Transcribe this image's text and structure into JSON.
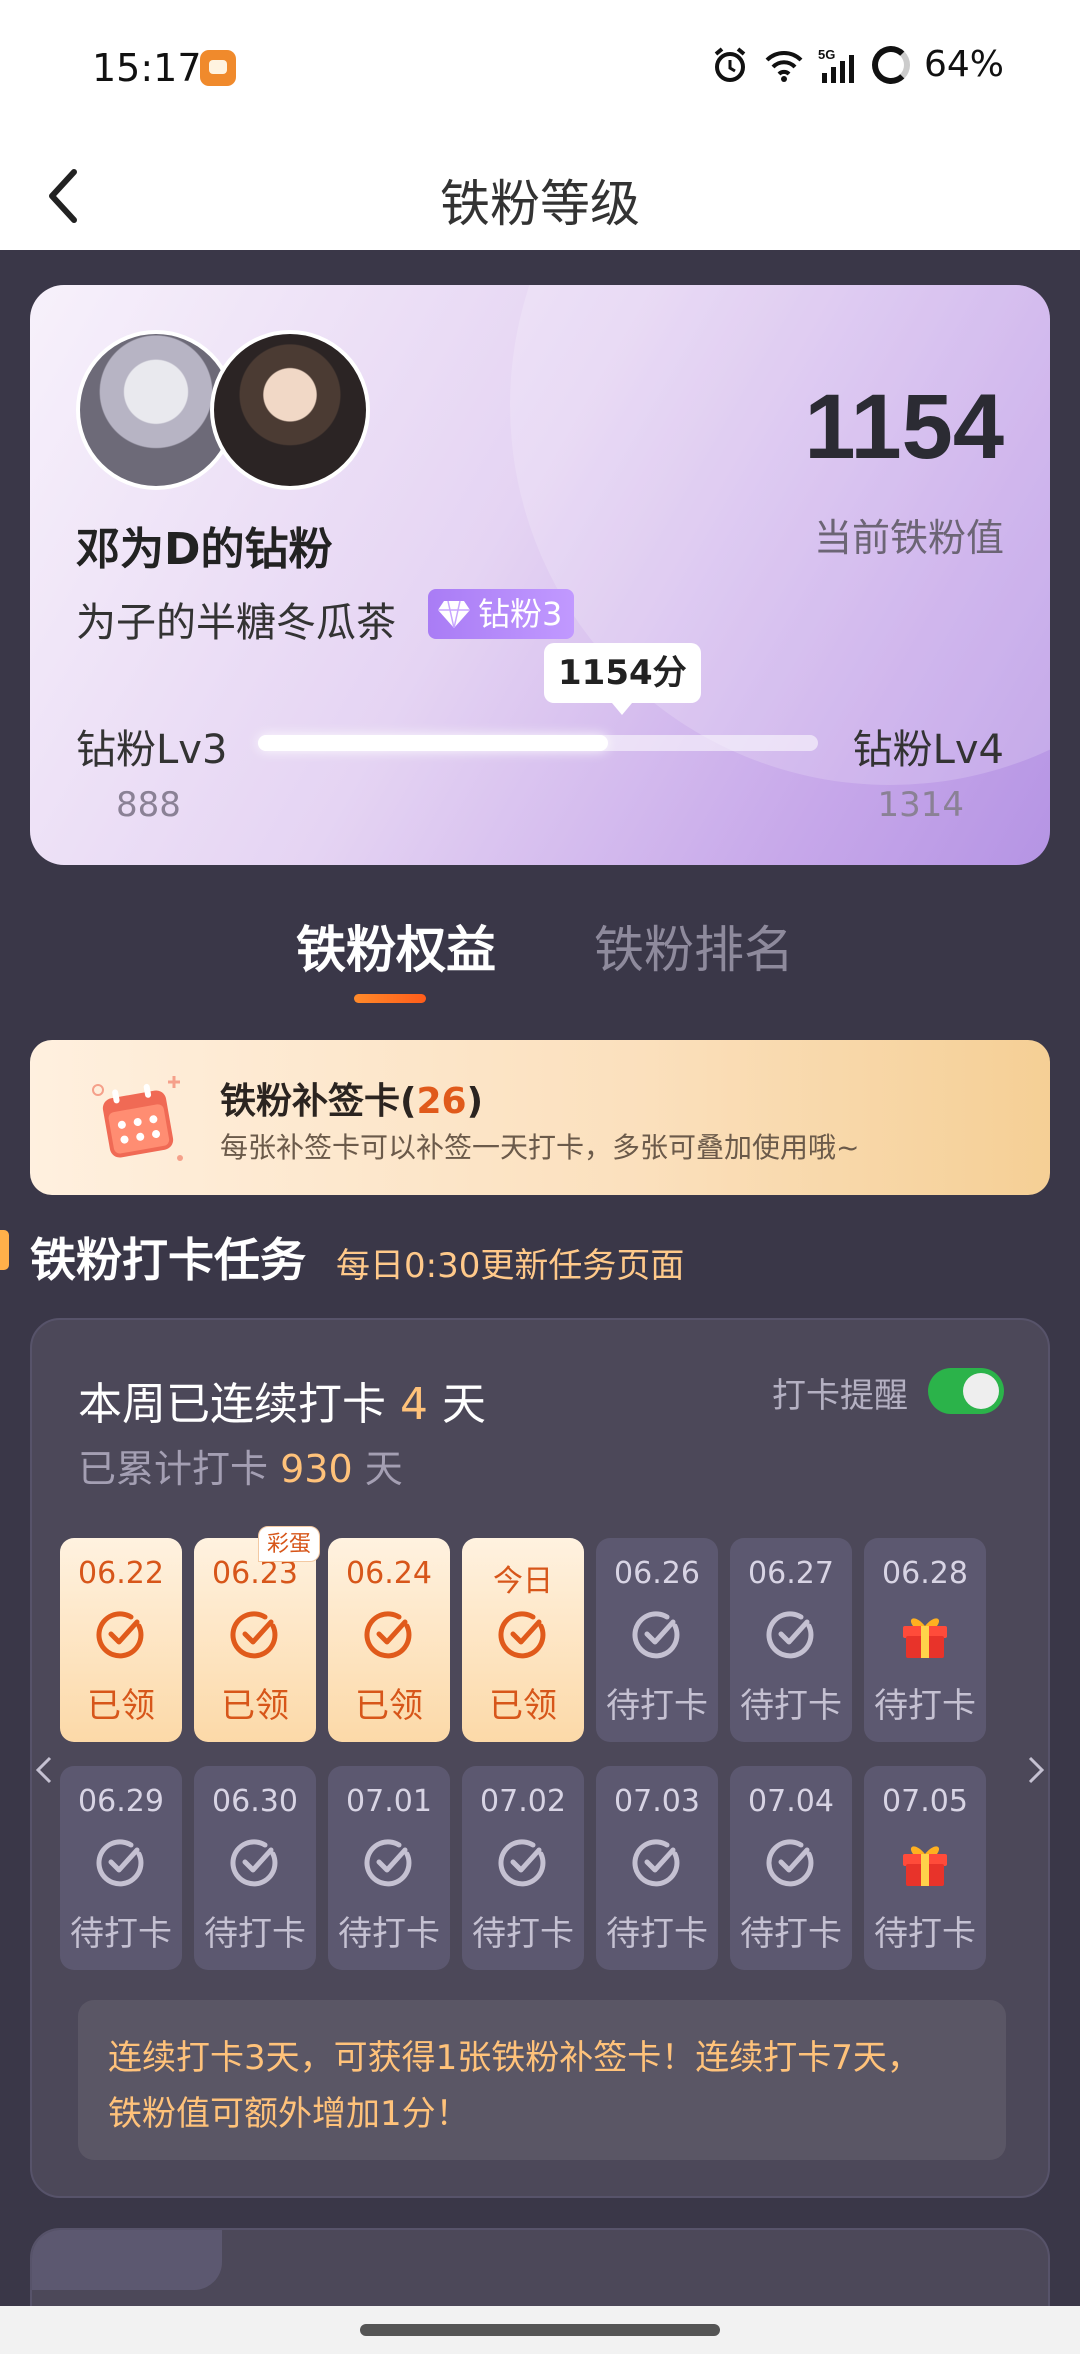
{
  "status_bar": {
    "time": "15:17",
    "battery": "64%",
    "icons": [
      "app-notification-icon",
      "alarm-icon",
      "wifi-icon",
      "5g-signal-icon",
      "battery-ring-icon"
    ]
  },
  "nav": {
    "title": "铁粉等级",
    "back_icon": "chevron-left-icon"
  },
  "profile": {
    "fan_name": "邓为D的钻粉",
    "nickname": "为子的半糖冬瓜茶",
    "badge_label": "钻粉3",
    "badge_icon": "diamond-icon",
    "score": "1154",
    "score_label": "当前铁粉值",
    "progress": {
      "tooltip": "1154分",
      "current": 1154,
      "min": 888,
      "max": 1314,
      "level_from": "钻粉Lv3",
      "level_to": "钻粉Lv4",
      "value_from": "888",
      "value_to": "1314"
    }
  },
  "tabs": [
    {
      "label": "铁粉权益",
      "active": true
    },
    {
      "label": "铁粉排名",
      "active": false
    }
  ],
  "supplement_card": {
    "title": "铁粉补签卡(",
    "count": "26",
    "title_end": ")",
    "description": "每张补签卡可以补签一天打卡，多张可叠加使用哦~",
    "icon": "calendar-icon"
  },
  "section": {
    "title": "铁粉打卡任务",
    "subtitle": "每日0:30更新任务页面"
  },
  "checkin": {
    "streak_prefix": "本周已连续打卡 ",
    "streak_days": "4",
    "streak_suffix": " 天",
    "total_prefix": "已累计打卡 ",
    "total_days": "930",
    "total_suffix": " 天",
    "reminder_label": "打卡提醒",
    "reminder_on": true,
    "egg_label": "彩蛋",
    "week1": [
      {
        "date": "06.22",
        "status": "已领",
        "done": true,
        "icon": "check-circle-icon"
      },
      {
        "date": "06.23",
        "status": "已领",
        "done": true,
        "icon": "check-circle-icon",
        "egg": true
      },
      {
        "date": "06.24",
        "status": "已领",
        "done": true,
        "icon": "check-circle-icon"
      },
      {
        "date": "今日",
        "status": "已领",
        "done": true,
        "icon": "check-circle-icon"
      },
      {
        "date": "06.26",
        "status": "待打卡",
        "done": false,
        "icon": "check-circle-icon"
      },
      {
        "date": "06.27",
        "status": "待打卡",
        "done": false,
        "icon": "check-circle-icon"
      },
      {
        "date": "06.28",
        "status": "待打卡",
        "done": false,
        "icon": "gift-icon"
      }
    ],
    "week2": [
      {
        "date": "06.29",
        "status": "待打卡",
        "done": false,
        "icon": "check-circle-icon"
      },
      {
        "date": "06.30",
        "status": "待打卡",
        "done": false,
        "icon": "check-circle-icon"
      },
      {
        "date": "07.01",
        "status": "待打卡",
        "done": false,
        "icon": "check-circle-icon"
      },
      {
        "date": "07.02",
        "status": "待打卡",
        "done": false,
        "icon": "check-circle-icon"
      },
      {
        "date": "07.03",
        "status": "待打卡",
        "done": false,
        "icon": "check-circle-icon"
      },
      {
        "date": "07.04",
        "status": "待打卡",
        "done": false,
        "icon": "check-circle-icon"
      },
      {
        "date": "07.05",
        "status": "待打卡",
        "done": false,
        "icon": "gift-icon"
      }
    ],
    "tip_line1": "连续打卡3天，可获得1张铁粉补签卡！连续打卡7天，",
    "tip_line2": "铁粉值可额外增加1分！"
  },
  "colors": {
    "accent_orange": "#e05a1b",
    "highlight_gold": "#ffc27a",
    "toggle_green": "#2bb34a",
    "background": "#3a3748"
  }
}
